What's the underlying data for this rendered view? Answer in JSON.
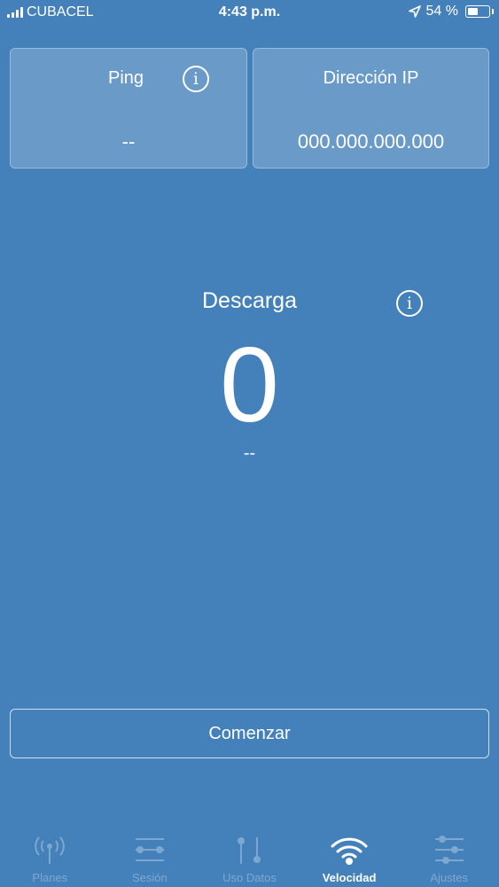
{
  "status_bar": {
    "carrier": "CUBACEL",
    "time": "4:43 p.m.",
    "battery_percent": "54 %",
    "battery_level": 0.54
  },
  "ping_card": {
    "title": "Ping",
    "value": "--"
  },
  "ip_card": {
    "title": "Dirección IP",
    "value": "000.000.000.000"
  },
  "download": {
    "label": "Descarga",
    "value": "0",
    "unit": "--"
  },
  "info_icon_glyph": "i",
  "start_button": {
    "label": "Comenzar"
  },
  "tab_bar": {
    "active_tab": "Velocidad",
    "tabs": [
      {
        "label": "Planes",
        "icon": "antenna-icon"
      },
      {
        "label": "Sesión",
        "icon": "session-icon"
      },
      {
        "label": "Uso Datos",
        "icon": "data-usage-icon"
      },
      {
        "label": "Velocidad",
        "icon": "wifi-icon"
      },
      {
        "label": "Ajustes",
        "icon": "settings-sliders-icon"
      }
    ]
  },
  "colors": {
    "background": "#4481bb",
    "text": "#ffffff",
    "card_fill": "rgba(255,255,255,0.2)"
  }
}
